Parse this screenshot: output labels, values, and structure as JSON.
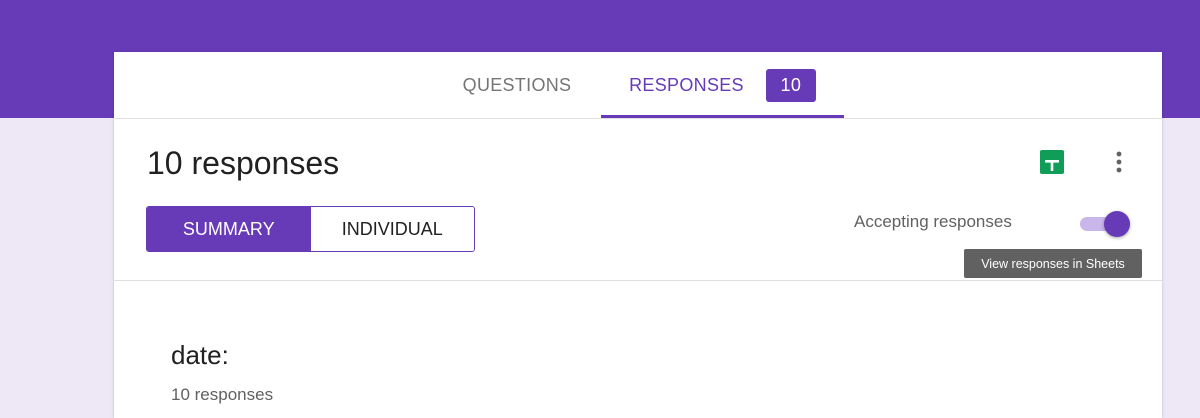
{
  "tabs": {
    "questions_label": "QUESTIONS",
    "responses_label": "RESPONSES",
    "responses_badge": "10"
  },
  "header": {
    "title": "10 responses",
    "segmented": {
      "summary_label": "SUMMARY",
      "individual_label": "INDIVIDUAL",
      "selected": "SUMMARY"
    },
    "sheets_icon": "google-sheets-icon",
    "more_icon": "more-vert-icon",
    "tooltip": "View responses in Sheets",
    "accepting_label": "Accepting responses",
    "accepting_on": true
  },
  "question": {
    "title": "date:",
    "count": "10 responses"
  },
  "colors": {
    "primary": "#673ab7",
    "background": "#ede7f6",
    "sheets_green": "#0f9d58"
  }
}
